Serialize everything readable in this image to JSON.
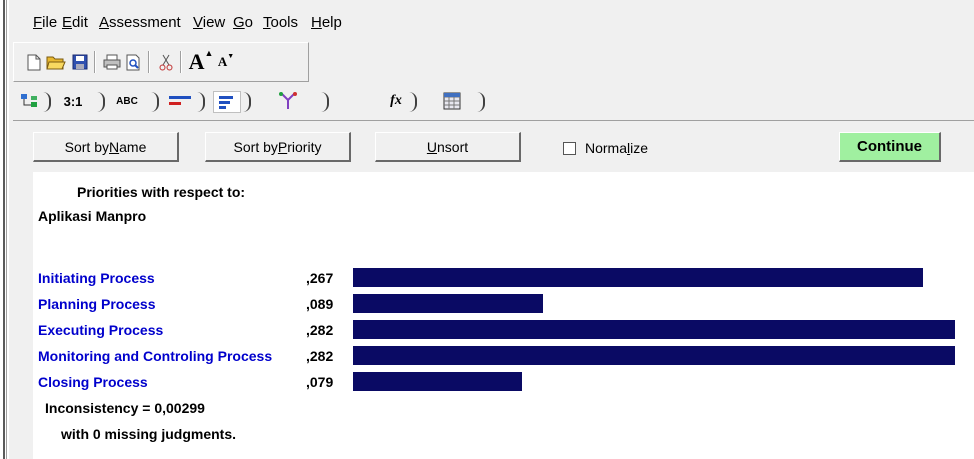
{
  "menu": [
    {
      "accel": "F",
      "rest": "ile"
    },
    {
      "accel": "E",
      "rest": "dit"
    },
    {
      "accel": "A",
      "rest": "ssessment"
    },
    {
      "accel": "V",
      "rest": "iew"
    },
    {
      "accel": "G",
      "rest": "o"
    },
    {
      "accel": "T",
      "rest": "ools"
    },
    {
      "accel": "H",
      "rest": "elp"
    }
  ],
  "toolbar": {
    "icons": [
      "new-file-icon",
      "open-folder-icon",
      "save-icon",
      "print-icon",
      "print-preview-icon",
      "cut-icon",
      "font-increase-icon",
      "font-decrease-icon"
    ],
    "font_up_glyph": "A",
    "font_down_glyph": "A"
  },
  "tabs": {
    "ratio_label": "3:1",
    "abc_label": "ABC",
    "fx_label": "fx"
  },
  "buttons": {
    "sort_name_pre": "Sort by ",
    "sort_name_acc": "N",
    "sort_name_post": "ame",
    "sort_priority_pre": "Sort by ",
    "sort_priority_acc": "P",
    "sort_priority_post": "riority",
    "unsort_acc": "U",
    "unsort_post": "nsort",
    "normalize_pre": "Norma",
    "normalize_acc": "l",
    "normalize_post": "ize",
    "continue": "Continue"
  },
  "panel": {
    "heading1": "Priorities with respect to:",
    "heading2": "Aplikasi Manpro",
    "items": [
      {
        "label": "Initiating Process",
        "value": ",267",
        "priority": 0.267
      },
      {
        "label": "Planning Process",
        "value": ",089",
        "priority": 0.089
      },
      {
        "label": "Executing Process",
        "value": ",282",
        "priority": 0.282
      },
      {
        "label": "Monitoring and Controling Process",
        "value": ",282",
        "priority": 0.282
      },
      {
        "label": "Closing Process",
        "value": ",079",
        "priority": 0.079
      }
    ],
    "inconsistency": "Inconsistency = 0,00299",
    "missing": "with 0  missing judgments.",
    "bar_color": "#0a0a64"
  },
  "colors": {
    "link_blue": "#0000cc",
    "continue_bg": "#a0f0a0"
  }
}
